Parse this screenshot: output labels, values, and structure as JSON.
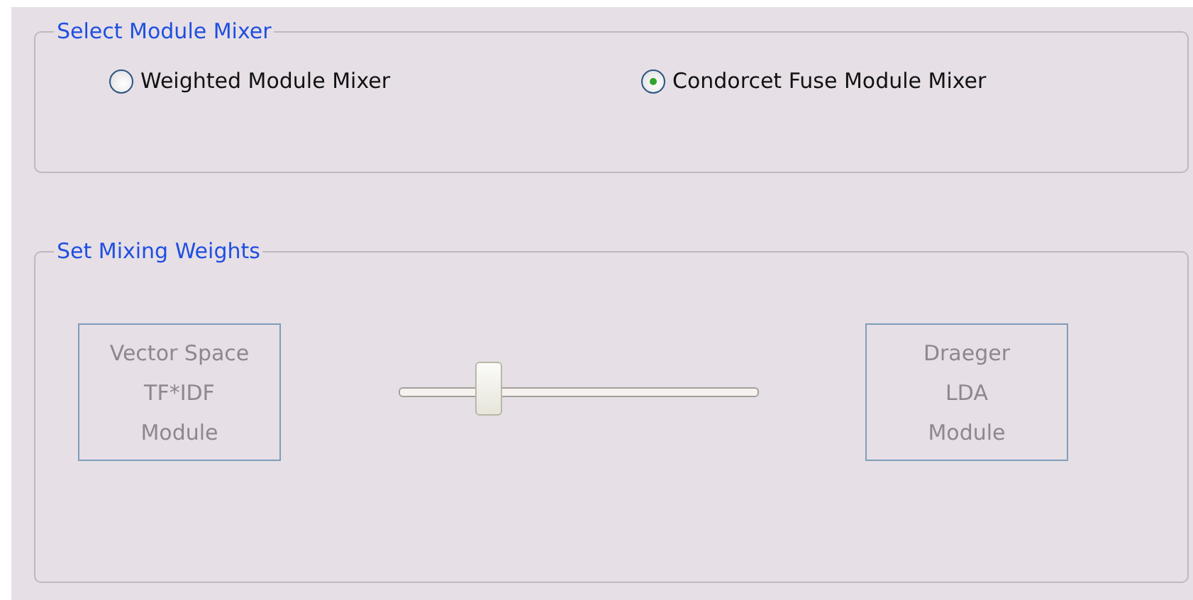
{
  "module_mixer": {
    "title": "Select Module Mixer",
    "options": [
      {
        "label": "Weighted Module Mixer",
        "selected": false
      },
      {
        "label": "Condorcet Fuse Module Mixer",
        "selected": true
      }
    ]
  },
  "mixing_weights": {
    "title": "Set Mixing Weights",
    "disabled": true,
    "left_module": [
      "Vector Space",
      "TF*IDF",
      "Module"
    ],
    "right_module": [
      "Draeger",
      "LDA",
      "Module"
    ],
    "slider": {
      "level": 0.25
    }
  }
}
